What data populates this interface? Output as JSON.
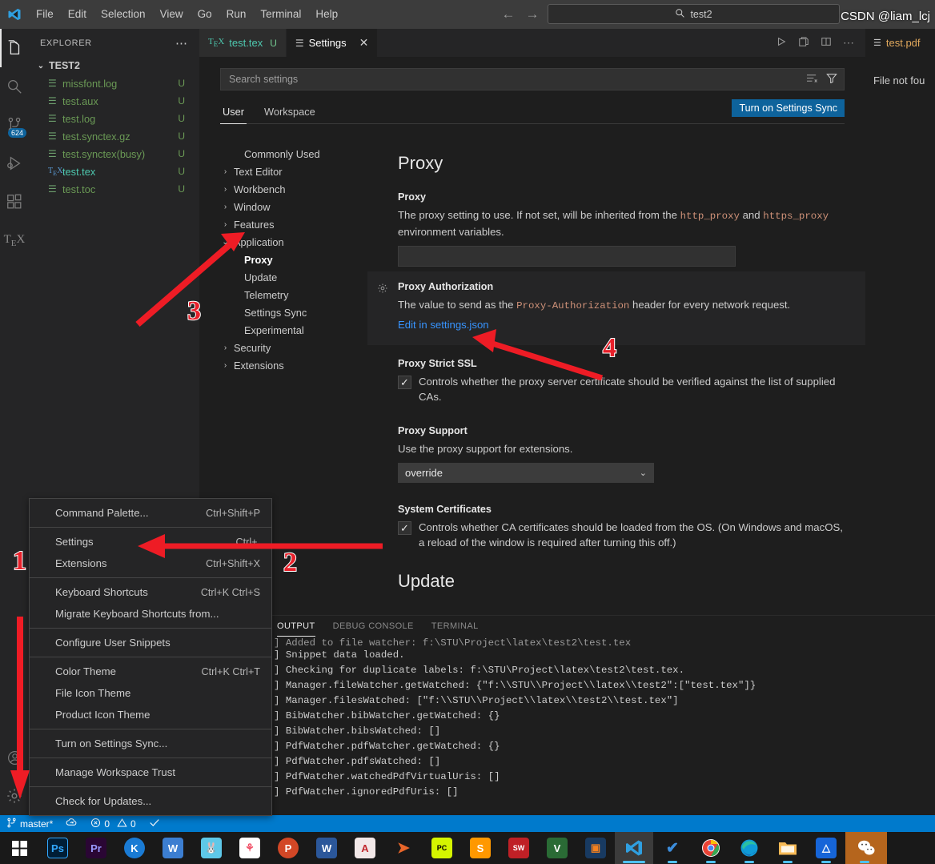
{
  "titlebar": {
    "logo_icon": "vscode-logo",
    "menus": [
      "File",
      "Edit",
      "Selection",
      "View",
      "Go",
      "Run",
      "Terminal",
      "Help"
    ],
    "back_icon": "arrow-left-icon",
    "forward_icon": "arrow-right-icon",
    "search_icon": "search-icon",
    "search_value": "test2"
  },
  "activitybar": {
    "items": [
      {
        "name": "explorer",
        "icon": "files-icon",
        "active": true,
        "badge": ""
      },
      {
        "name": "search",
        "icon": "search-icon",
        "active": false,
        "badge": ""
      },
      {
        "name": "source-control",
        "icon": "source-control-icon",
        "active": false,
        "badge": "624"
      },
      {
        "name": "run-and-debug",
        "icon": "debug-icon",
        "active": false,
        "badge": ""
      },
      {
        "name": "extensions",
        "icon": "extensions-icon",
        "active": false,
        "badge": ""
      },
      {
        "name": "latex-workshop",
        "icon": "tex-icon",
        "active": false,
        "badge": ""
      }
    ],
    "bottom": [
      {
        "name": "accounts",
        "icon": "account-icon"
      },
      {
        "name": "manage",
        "icon": "gear-icon"
      }
    ]
  },
  "explorer": {
    "title": "EXPLORER",
    "more_icon": "ellipsis-icon",
    "root": "TEST2",
    "root_chevron": "chevron-down-icon",
    "files": [
      {
        "name": "missfont.log",
        "badge": "U",
        "icon": "log-file-icon",
        "kind": "log"
      },
      {
        "name": "test.aux",
        "badge": "U",
        "icon": "log-file-icon",
        "kind": "log"
      },
      {
        "name": "test.log",
        "badge": "U",
        "icon": "log-file-icon",
        "kind": "log"
      },
      {
        "name": "test.synctex.gz",
        "badge": "U",
        "icon": "log-file-icon",
        "kind": "log"
      },
      {
        "name": "test.synctex(busy)",
        "badge": "U",
        "icon": "log-file-icon",
        "kind": "log"
      },
      {
        "name": "test.tex",
        "badge": "U",
        "icon": "tex-file-icon",
        "kind": "tex"
      },
      {
        "name": "test.toc",
        "badge": "U",
        "icon": "log-file-icon",
        "kind": "log"
      }
    ]
  },
  "tabs": [
    {
      "label": "test.tex",
      "icon": "tex-file-icon",
      "badge": "U",
      "active": false
    },
    {
      "label": "Settings",
      "icon": "settings-gear-icon",
      "badge": "",
      "active": true,
      "close_icon": "close-icon"
    }
  ],
  "tab_actions": [
    {
      "name": "run-icon",
      "glyph": "▷"
    },
    {
      "name": "split-terminal-icon",
      "glyph": "⧉"
    },
    {
      "name": "split-editor-icon",
      "glyph": "▯▯"
    },
    {
      "name": "more-actions-icon",
      "glyph": "⋯"
    }
  ],
  "settings": {
    "search_placeholder": "Search settings",
    "clear_filter_icon": "clear-filters-icon",
    "filter_icon": "filter-icon",
    "tabs": [
      {
        "label": "User",
        "active": true
      },
      {
        "label": "Workspace",
        "active": false
      }
    ],
    "sync_button": "Turn on Settings Sync",
    "toc": [
      {
        "label": "Commonly Used",
        "level": 0,
        "chevron": "",
        "selected": false
      },
      {
        "label": "Text Editor",
        "level": 0,
        "chevron": "chevron-right-icon",
        "selected": false
      },
      {
        "label": "Workbench",
        "level": 0,
        "chevron": "chevron-right-icon",
        "selected": false
      },
      {
        "label": "Window",
        "level": 0,
        "chevron": "chevron-right-icon",
        "selected": false
      },
      {
        "label": "Features",
        "level": 0,
        "chevron": "chevron-right-icon",
        "selected": false
      },
      {
        "label": "Application",
        "level": 0,
        "chevron": "chevron-down-icon",
        "selected": false
      },
      {
        "label": "Proxy",
        "level": 1,
        "chevron": "",
        "selected": true
      },
      {
        "label": "Update",
        "level": 1,
        "chevron": "",
        "selected": false
      },
      {
        "label": "Telemetry",
        "level": 1,
        "chevron": "",
        "selected": false
      },
      {
        "label": "Settings Sync",
        "level": 1,
        "chevron": "",
        "selected": false
      },
      {
        "label": "Experimental",
        "level": 1,
        "chevron": "",
        "selected": false
      },
      {
        "label": "Security",
        "level": 0,
        "chevron": "chevron-right-icon",
        "selected": false
      },
      {
        "label": "Extensions",
        "level": 0,
        "chevron": "chevron-right-icon",
        "selected": false
      }
    ],
    "page_title": "Proxy",
    "items": {
      "proxy": {
        "label": "Proxy",
        "desc_1": "The proxy setting to use. If not set, will be inherited from the ",
        "code_1": "http_proxy",
        "desc_2": " and ",
        "code_2": "https_proxy",
        "desc_3": " environment variables.",
        "value": ""
      },
      "proxy_authorization": {
        "gear_icon": "modified-setting-gear-icon",
        "label": "Proxy Authorization",
        "desc_1": "The value to send as the ",
        "code_1": "Proxy-Authorization",
        "desc_2": " header for every network request.",
        "link": "Edit in settings.json"
      },
      "proxy_strict_ssl": {
        "label": "Proxy Strict SSL",
        "checked": true,
        "check_glyph": "✓",
        "desc": "Controls whether the proxy server certificate should be verified against the list of supplied CAs."
      },
      "proxy_support": {
        "label": "Proxy Support",
        "desc": "Use the proxy support for extensions.",
        "value": "override",
        "chevron": "chevron-down-icon"
      },
      "system_certificates": {
        "label": "System Certificates",
        "checked": true,
        "check_glyph": "✓",
        "desc": "Controls whether CA certificates should be loaded from the OS. (On Windows and macOS, a reload of the window is required after turning this off.)"
      },
      "next_section": "Update"
    }
  },
  "pdf_pane": {
    "tab_label": "test.pdf",
    "tab_icon": "pdf-file-icon",
    "body_text": "File not fou"
  },
  "panel": {
    "tabs": [
      {
        "label": "OUTPUT",
        "active": true
      },
      {
        "label": "DEBUG CONSOLE",
        "active": false
      },
      {
        "label": "TERMINAL",
        "active": false
      }
    ],
    "lines": [
      "] Added to file watcher: f:\\STU\\Project\\latex\\test2\\test.tex",
      "] Snippet data loaded.",
      "] Checking for duplicate labels: f:\\STU\\Project\\latex\\test2\\test.tex.",
      "] Manager.fileWatcher.getWatched: {\"f:\\\\STU\\\\Project\\\\latex\\\\test2\":[\"test.tex\"]}",
      "] Manager.filesWatched: [\"f:\\\\STU\\\\Project\\\\latex\\\\test2\\\\test.tex\"]",
      "] BibWatcher.bibWatcher.getWatched: {}",
      "] BibWatcher.bibsWatched: []",
      "] PdfWatcher.pdfWatcher.getWatched: {}",
      "] PdfWatcher.pdfsWatched: []",
      "] PdfWatcher.watchedPdfVirtualUris: []",
      "] PdfWatcher.ignoredPdfUris: []"
    ]
  },
  "context_menu": [
    {
      "label": "Command Palette...",
      "key": "Ctrl+Shift+P",
      "sep_after": true
    },
    {
      "label": "Settings",
      "key": "Ctrl+,",
      "sep_after": false
    },
    {
      "label": "Extensions",
      "key": "Ctrl+Shift+X",
      "sep_after": true
    },
    {
      "label": "Keyboard Shortcuts",
      "key": "Ctrl+K Ctrl+S",
      "sep_after": false
    },
    {
      "label": "Migrate Keyboard Shortcuts from...",
      "key": "",
      "sep_after": true
    },
    {
      "label": "Configure User Snippets",
      "key": "",
      "sep_after": true
    },
    {
      "label": "Color Theme",
      "key": "Ctrl+K Ctrl+T",
      "sep_after": false
    },
    {
      "label": "File Icon Theme",
      "key": "",
      "sep_after": false
    },
    {
      "label": "Product Icon Theme",
      "key": "",
      "sep_after": true
    },
    {
      "label": "Turn on Settings Sync...",
      "key": "",
      "sep_after": true
    },
    {
      "label": "Manage Workspace Trust",
      "key": "",
      "sep_after": true
    },
    {
      "label": "Check for Updates...",
      "key": "",
      "sep_after": false
    }
  ],
  "statusbar": {
    "branch_icon": "source-control-branch-icon",
    "branch": "master*",
    "sync_icon": "cloud-sync-icon",
    "error_icon": "error-circle-icon",
    "errors": "0",
    "warning_icon": "warning-triangle-icon",
    "warnings": "0",
    "check_icon": "check-icon"
  },
  "taskbar": {
    "items": [
      {
        "name": "start-button",
        "label": "⊞",
        "bg": "transparent",
        "fg": "#ffffff"
      },
      {
        "name": "photoshop-icon",
        "label": "Ps",
        "bg": "#001e36",
        "fg": "#31a8ff"
      },
      {
        "name": "premiere-icon",
        "label": "Pr",
        "bg": "#2a0634",
        "fg": "#9999ff"
      },
      {
        "name": "kugou-icon",
        "label": "K",
        "bg": "#1a7bd4",
        "fg": "#ffffff"
      },
      {
        "name": "wps-icon",
        "label": "W",
        "bg": "#3c7ed1",
        "fg": "#ffffff"
      },
      {
        "name": "rabbit-icon",
        "label": "",
        "bg": "#5ec8e8",
        "fg": "#ffffff"
      },
      {
        "name": "clover-icon",
        "label": "",
        "bg": "#ffffff",
        "fg": "#f04b63"
      },
      {
        "name": "powerpoint-icon",
        "label": "P",
        "bg": "#d24726",
        "fg": "#ffffff"
      },
      {
        "name": "word-icon",
        "label": "W",
        "bg": "#2b579a",
        "fg": "#ffffff"
      },
      {
        "name": "autocad-icon",
        "label": "A",
        "bg": "#f2e8e8",
        "fg": "#c1272d"
      },
      {
        "name": "matlab-icon",
        "label": "",
        "bg": "transparent",
        "fg": "#e8662a"
      },
      {
        "name": "pycharm-icon",
        "label": "PC",
        "bg": "#d5f500",
        "fg": "#000000"
      },
      {
        "name": "sublime-icon",
        "label": "S",
        "bg": "#ff9800",
        "fg": "#ffffff"
      },
      {
        "name": "solidworks-icon",
        "label": "SW",
        "bg": "#bf2026",
        "fg": "#ffffff"
      },
      {
        "name": "visio-icon",
        "label": "V",
        "bg": "#2a6b35",
        "fg": "#ffffff"
      },
      {
        "name": "virtualbox-icon",
        "label": "",
        "bg": "#183a61",
        "fg": "#f5821f"
      },
      {
        "name": "vscode-taskbar-icon",
        "label": "",
        "bg": "transparent",
        "fg": "#2f9fe0",
        "active": true
      },
      {
        "name": "todo-check-icon",
        "label": "✔",
        "bg": "transparent",
        "fg": "#3c8ddc",
        "running": true
      },
      {
        "name": "chrome-icon",
        "label": "",
        "bg": "transparent",
        "fg": "#4285f4",
        "running": true
      },
      {
        "name": "edge-icon",
        "label": "",
        "bg": "transparent",
        "fg": "#0f9bd7",
        "running": true
      },
      {
        "name": "file-explorer-icon",
        "label": "",
        "bg": "#f7b955",
        "fg": "#ffffff",
        "running": true
      },
      {
        "name": "onedrive-icon",
        "label": "",
        "bg": "#1665d8",
        "fg": "#ffffff",
        "running": true
      },
      {
        "name": "wechat-icon",
        "label": "",
        "bg": "#b5651d",
        "fg": "#2dc100",
        "running": true
      }
    ]
  },
  "annotations": {
    "n1": "1",
    "n2": "2",
    "n3": "3",
    "n4": "4"
  },
  "watermark": "CSDN @liam_lcj",
  "colors": {
    "accent": "#007acc",
    "button": "#0e639c",
    "link": "#3794ff",
    "annotation_red": "#e8202a",
    "tex_green": "#4ec9b0",
    "file_green": "#6a9955"
  }
}
